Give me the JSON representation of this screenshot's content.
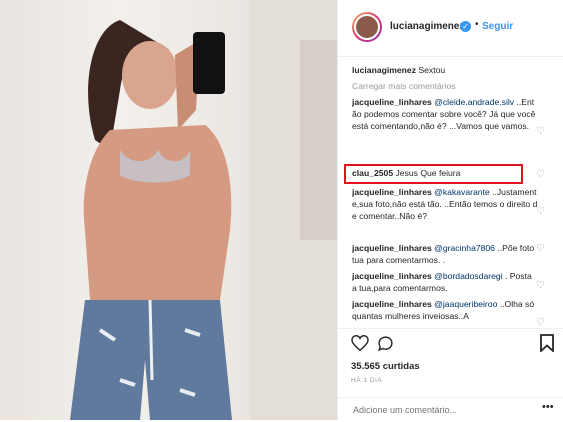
{
  "post": {
    "username": "lucianagimenez",
    "follow_label": "Seguir",
    "caption_user": "lucianagimenez",
    "caption_text": "Sextou",
    "load_more": "Carregar mais comentários"
  },
  "comments": [
    {
      "user": "jacqueline_linhares",
      "mention": "@cleide.andrade.silv",
      "text": " ..Então podemos comentar sobre você? Já que você está comentando,não é? ...Vamos que vamos."
    },
    {
      "user": "clau_2505",
      "mention": "",
      "text": " Jesus Que feiura"
    },
    {
      "user": "jacqueline_linhares",
      "mention": "@kakavarante",
      "text": " ..Justamente,sua foto,não está tão. ..Então temos o direito de comentar..Não é?"
    },
    {
      "user": "jacqueline_linhares",
      "mention": "@gracinha7806",
      "text": " ..Põe foto tua para comentarmos. ."
    },
    {
      "user": "jacqueline_linhares",
      "mention": "@bordadosdaregi",
      "text": " . Posta a tua,para comentarmos."
    },
    {
      "user": "jacqueline_linhares",
      "mention": "@jaaqueribeiroo",
      "text": " ..Olha só quantas mulheres inveiosas..A"
    }
  ],
  "footer": {
    "likes": "35.565 curtidas",
    "time": "HÁ 1 DIA",
    "comment_placeholder": "Adicione um comentário..."
  },
  "colors": {
    "highlight": "#e2121e",
    "link": "#3897f0"
  }
}
